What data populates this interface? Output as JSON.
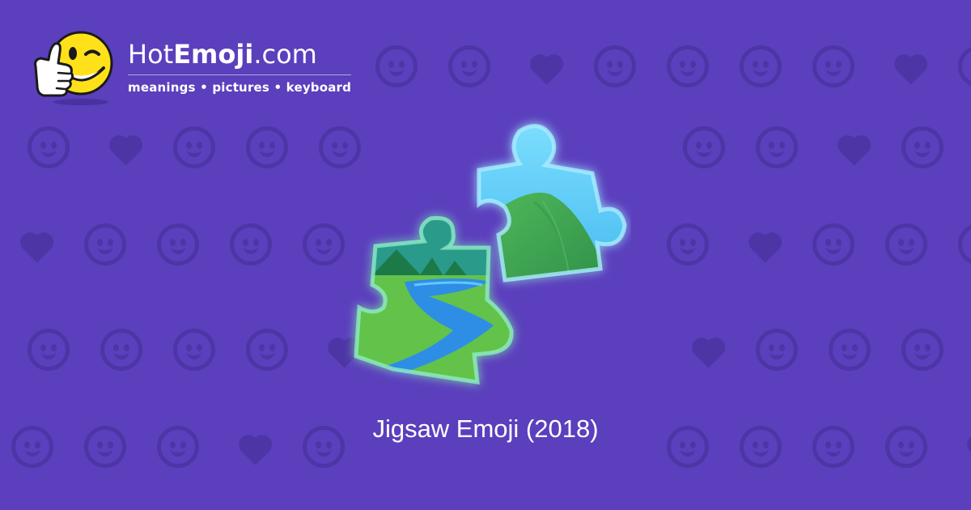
{
  "brand": {
    "name_prefix": "Hot",
    "name_bold": "Emoji",
    "name_suffix": ".com",
    "tagline": "meanings • pictures • keyboard"
  },
  "caption": "Jigsaw Emoji (2018)",
  "colors": {
    "background": "#5b3fbd",
    "pattern": "#4e35a6",
    "text": "#ffffff"
  },
  "icons": {
    "logo": "thumbs-up-winking-smiley-icon",
    "main": "jigsaw-puzzle-pieces-icon"
  }
}
